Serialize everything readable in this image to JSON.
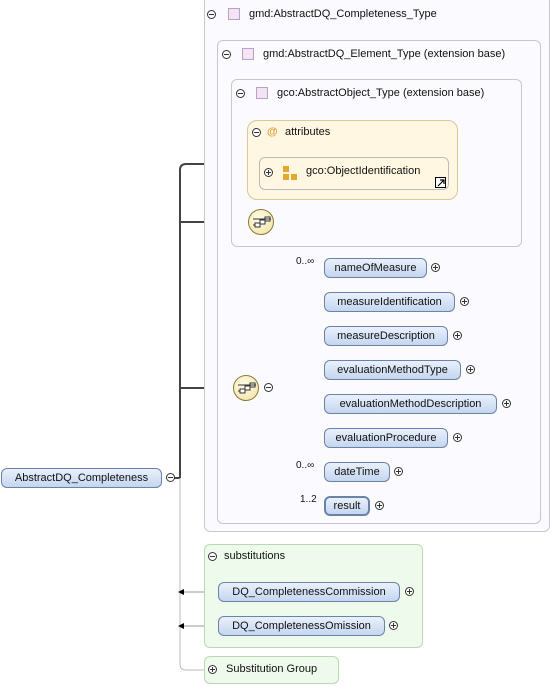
{
  "diagram": {
    "root": "AbstractDQ_Completeness",
    "completeness_type": "gmd:AbstractDQ_Completeness_Type",
    "element_type": "gmd:AbstractDQ_Element_Type (extension base)",
    "object_type": "gco:AbstractObject_Type (extension base)",
    "attributes": {
      "at_symbol": "@",
      "label": "attributes",
      "item": "gco:ObjectIdentification"
    },
    "elements": [
      {
        "name": "nameOfMeasure",
        "cardinality": "0..∞"
      },
      {
        "name": "measureIdentification",
        "cardinality": ""
      },
      {
        "name": "measureDescription",
        "cardinality": ""
      },
      {
        "name": "evaluationMethodType",
        "cardinality": ""
      },
      {
        "name": "evaluationMethodDescription",
        "cardinality": ""
      },
      {
        "name": "evaluationProcedure",
        "cardinality": ""
      },
      {
        "name": "dateTime",
        "cardinality": "0..∞"
      },
      {
        "name": "result",
        "cardinality": "1..2"
      }
    ],
    "substitutions": {
      "label": "substitutions",
      "items": [
        "DQ_CompletenessCommission",
        "DQ_CompletenessOmission"
      ]
    },
    "substitution_group": "Substitution Group"
  }
}
